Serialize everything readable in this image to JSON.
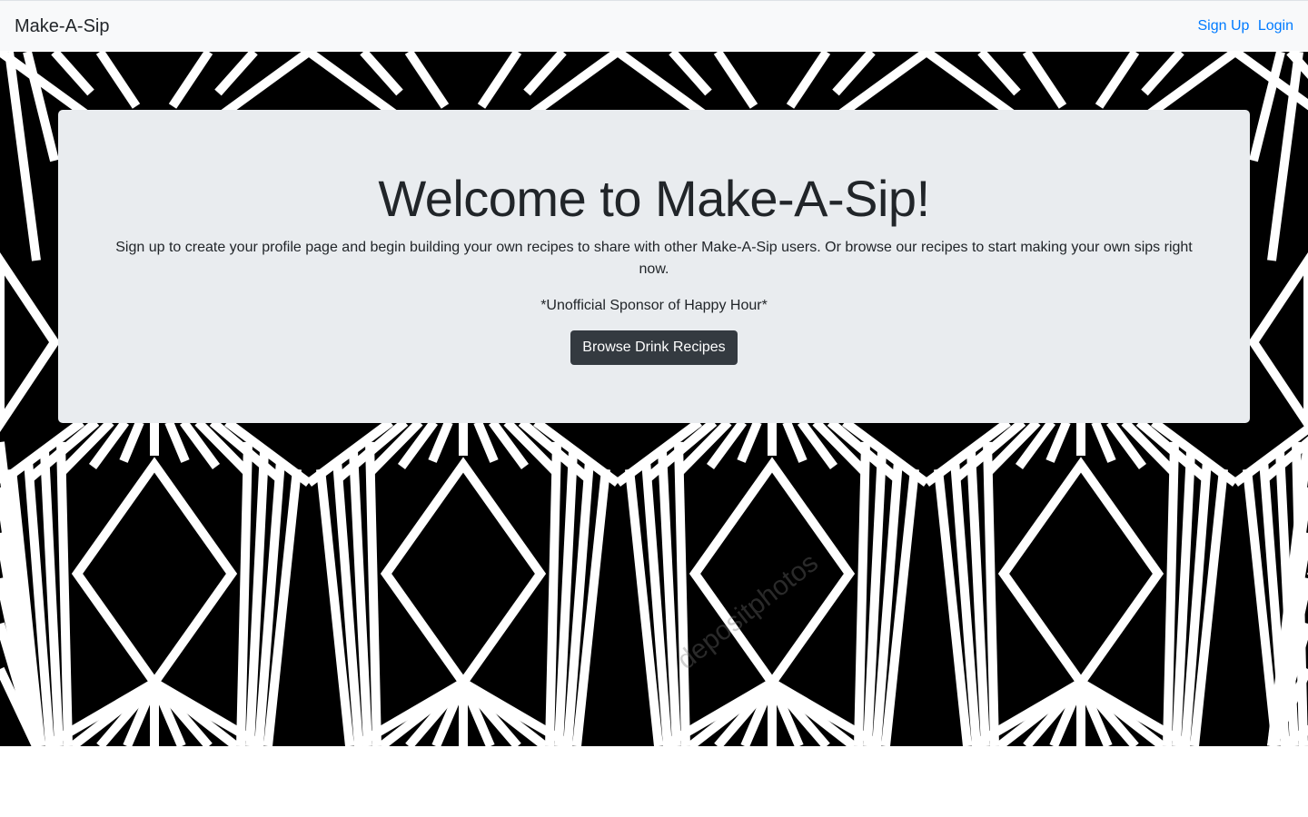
{
  "navbar": {
    "brand": "Make-A-Sip",
    "links": [
      "Sign Up",
      "Login"
    ]
  },
  "jumbotron": {
    "title": "Welcome to Make-A-Sip!",
    "lead": "Sign up to create your profile page and begin building your own recipes to share with other Make-A-Sip users. Or browse our recipes to start making your own sips right now.",
    "tagline": "*Unofficial Sponsor of Happy Hour*",
    "button_label": "Browse Drink Recipes"
  },
  "background": {
    "pattern": "art-deco-geometric",
    "colors": {
      "fill": "#000000",
      "stroke": "#ffffff"
    },
    "watermark": "depositphotos"
  },
  "colors": {
    "navbar_bg": "#f8f9fa",
    "link": "#007bff",
    "jumbotron_bg": "#e9ecef",
    "button_bg": "#343a40"
  }
}
